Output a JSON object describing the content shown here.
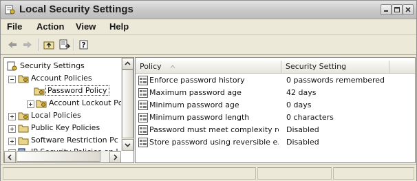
{
  "window": {
    "title": "Local Security Settings"
  },
  "menu": [
    "File",
    "Action",
    "View",
    "Help"
  ],
  "toolbar": {
    "icons": [
      "back-arrow-icon",
      "forward-arrow-icon",
      "up-one-level-icon",
      "export-list-icon",
      "help-icon"
    ]
  },
  "tree": {
    "items": [
      {
        "label": "Security Settings",
        "icon": "security-settings-icon"
      },
      {
        "label": "Account Policies",
        "icon": "folder-icon"
      },
      {
        "label": "Password Policy",
        "icon": "folder-icon"
      },
      {
        "label": "Account Lockout Pc",
        "icon": "folder-icon"
      },
      {
        "label": "Local Policies",
        "icon": "folder-icon"
      },
      {
        "label": "Public Key Policies",
        "icon": "folder-icon"
      },
      {
        "label": "Software Restriction Pc",
        "icon": "folder-icon"
      },
      {
        "label": "IP Security Policies on I",
        "icon": "ip-security-icon"
      }
    ]
  },
  "list": {
    "columns": [
      "Policy",
      "Security Setting"
    ],
    "rows": [
      {
        "policy": "Enforce password history",
        "setting": "0 passwords remembered"
      },
      {
        "policy": "Maximum password age",
        "setting": "42 days"
      },
      {
        "policy": "Minimum password age",
        "setting": "0 days"
      },
      {
        "policy": "Minimum password length",
        "setting": "0 characters"
      },
      {
        "policy": "Password must meet complexity re...",
        "setting": "Disabled"
      },
      {
        "policy": "Store password using reversible e...",
        "setting": "Disabled"
      }
    ]
  },
  "colors": {
    "folder": "#e8d48a",
    "selection_border": "#333333"
  }
}
